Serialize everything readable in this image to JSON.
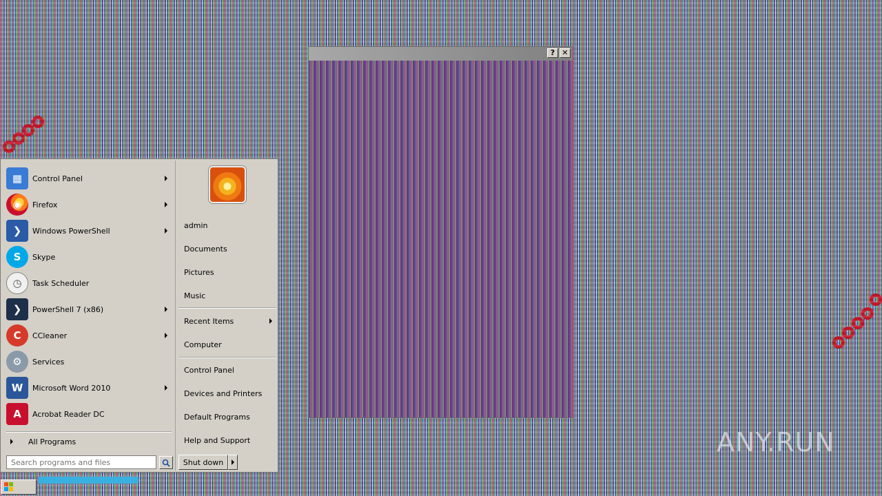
{
  "dialog": {
    "help_glyph": "?",
    "close_glyph": "✕"
  },
  "start_menu": {
    "programs": [
      {
        "label": "Control Panel",
        "icon": "control-panel-icon",
        "color": "#3a7bd5",
        "glyph": "▦",
        "submenu": true
      },
      {
        "label": "Firefox",
        "icon": "firefox-icon",
        "color": "#ff7a18",
        "glyph": "◉",
        "submenu": true
      },
      {
        "label": "Windows PowerShell",
        "icon": "powershell-icon",
        "color": "#2b5aa6",
        "glyph": "❯",
        "submenu": true
      },
      {
        "label": "Skype",
        "icon": "skype-icon",
        "color": "#00a8e8",
        "glyph": "S",
        "submenu": false
      },
      {
        "label": "Task Scheduler",
        "icon": "clock-icon",
        "color": "#c8c8c8",
        "glyph": "◷",
        "submenu": false
      },
      {
        "label": "PowerShell 7 (x86)",
        "icon": "powershell-7-icon",
        "color": "#1e2f4a",
        "glyph": "❯",
        "submenu": true
      },
      {
        "label": "CCleaner",
        "icon": "ccleaner-icon",
        "color": "#d63a2a",
        "glyph": "C",
        "submenu": true
      },
      {
        "label": "Services",
        "icon": "gears-icon",
        "color": "#8a9aa8",
        "glyph": "⚙",
        "submenu": false
      },
      {
        "label": "Microsoft Word 2010",
        "icon": "word-icon",
        "color": "#2b579a",
        "glyph": "W",
        "submenu": true
      },
      {
        "label": "Acrobat Reader DC",
        "icon": "acrobat-icon",
        "color": "#c8102e",
        "glyph": "A",
        "submenu": false
      }
    ],
    "all_programs": "All Programs",
    "search_placeholder": "Search programs and files",
    "right_links": [
      {
        "label": "admin"
      },
      {
        "label": "Documents"
      },
      {
        "label": "Pictures"
      },
      {
        "label": "Music"
      },
      {
        "label": "Recent Items",
        "submenu": true
      },
      {
        "label": "Computer"
      },
      {
        "label": "Control Panel"
      },
      {
        "label": "Devices and Printers"
      },
      {
        "label": "Default Programs"
      },
      {
        "label": "Help and Support"
      }
    ],
    "shutdown_label": "Shut down"
  },
  "watermark": "ANY.RUN"
}
